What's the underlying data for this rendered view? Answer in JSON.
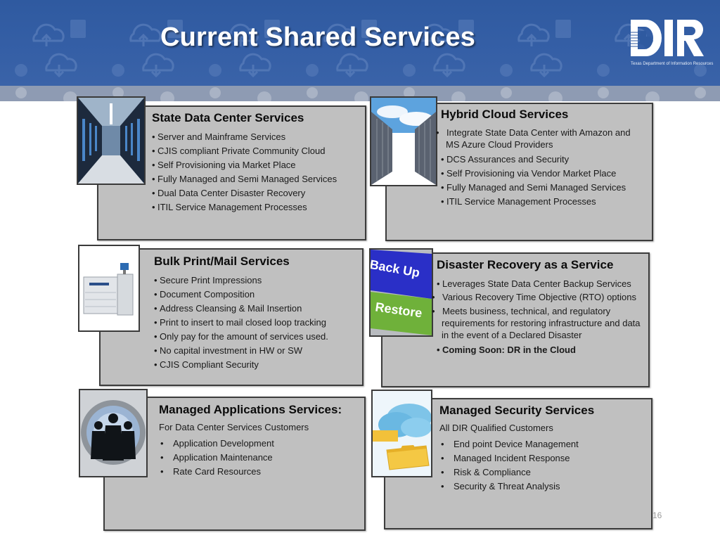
{
  "slide": {
    "title": "Current Shared Services",
    "page_number": "16",
    "logo": {
      "text": "DIR",
      "tagline": "Texas Department of Information Resources",
      "icon": "texas-map-icon"
    },
    "colors": {
      "banner": "#2f5aa0",
      "strip": "#8e9bb3",
      "card_fill": "#c0c0c0",
      "card_border": "#3c3c3c"
    }
  },
  "cards": [
    {
      "title": "State Data Center Services",
      "image": "data-center-aisle-image",
      "bullets": [
        "Server and Mainframe Services",
        "CJIS compliant Private Community Cloud",
        "Self Provisioning via Market Place",
        "Fully Managed and Semi Managed Services",
        "Dual Data Center Disaster Recovery",
        "ITIL Service Management Processes"
      ]
    },
    {
      "title": "Hybrid Cloud Services",
      "image": "cloud-server-aisle-image",
      "bullets": [
        "Integrate State Data Center with Amazon and MS Azure Cloud Providers",
        "DCS Assurances and Security",
        "Self Provisioning via Vendor Market Place",
        "Fully Managed and Semi Managed Services",
        "ITIL Service Management Processes"
      ]
    },
    {
      "title": "Bulk Print/Mail Services",
      "image": "production-printer-image",
      "bullets": [
        "Secure Print Impressions",
        "Document Composition",
        "Address Cleansing & Mail Insertion",
        "Print to insert to mail closed loop tracking",
        "Only pay for the amount of services used.",
        "No capital investment in HW or SW",
        "CJIS Compliant Security"
      ]
    },
    {
      "title": "Disaster Recovery as a Service",
      "image": "backup-restore-keys-image",
      "image_labels": [
        "Back Up",
        "Restore"
      ],
      "bullets": [
        "Leverages State Data Center Backup Services",
        "Various Recovery Time Objective (RTO) options",
        "Meets business, technical, and regulatory requirements for restoring infrastructure and data in the event of a Declared Disaster",
        "Coming Soon:  DR in the Cloud"
      ]
    },
    {
      "title": "Managed Applications Services:",
      "image": "business-team-gear-image",
      "subtitle": "For Data Center Services Customers",
      "bullets": [
        "Application Development",
        "Application Maintenance",
        "Rate Card Resources"
      ]
    },
    {
      "title": "Managed Security Services",
      "image": "cloud-folders-image",
      "subtitle": "All DIR Qualified Customers",
      "bullets": [
        "End point Device Management",
        "Managed Incident Response",
        "Risk & Compliance",
        "Security & Threat Analysis"
      ]
    }
  ]
}
